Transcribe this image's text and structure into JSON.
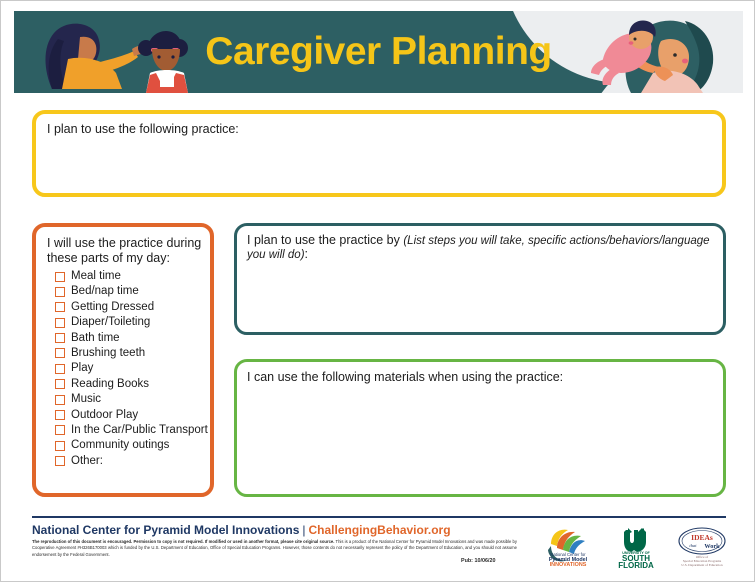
{
  "header": {
    "title": "Caregiver Planning",
    "banner_color": "#2d5f63",
    "title_color": "#f5c518",
    "left_illustration": "caregiver-styling-childs-hair-illustration",
    "right_illustration": "caregiver-holding-baby-illustration"
  },
  "sections": {
    "practice": {
      "label": "I plan to use the following practice:",
      "border_color": "#f7c71b"
    },
    "checklist": {
      "heading": "I will use the practice during these parts of my day:",
      "border_color": "#e0662a",
      "items": [
        "Meal time",
        "Bed/nap time",
        "Getting Dressed",
        "Diaper/Toileting",
        "Bath time",
        "Brushing teeth",
        "Play",
        "Reading Books",
        "Music",
        "Outdoor Play",
        "In the Car/Public Transport",
        "Community outings",
        "Other:"
      ]
    },
    "steps": {
      "label": "I plan to use the practice by ",
      "hint": "(List steps you will take, specific actions/behaviors/language you will do)",
      "suffix": ":",
      "border_color": "#2c5f63"
    },
    "materials": {
      "label": "I can use the following materials when using the practice:",
      "border_color": "#67b544"
    }
  },
  "footer": {
    "org": "National Center for Pyramid Model Innovations",
    "separator": "|",
    "url": "ChallengingBehavior.org",
    "org_color": "#1f3864",
    "url_color": "#e0662a",
    "fine_print_bold_1": "The reproduction of this document is encouraged. Permission to copy is not required. If modified or used in another format, please cite original source.",
    "fine_print_rest": " This is a product of the National Center for Pyramid Model Innovations and was made possible by Cooperative Agreement #H326B170003 which is funded by the U.S. Department of Education, Office of Special Education Programs. However, those contents do not necessarily represent the policy of the Department of Education, and you should not assume endorsement by the Federal Government.",
    "pub_date": "Pub: 10/06/20",
    "logos": [
      {
        "name": "ncpmi-logo",
        "line1": "National Center for",
        "line2": "Pyramid Model",
        "line3": "INNOVATIONS"
      },
      {
        "name": "usf-logo",
        "line1": "UNIVERSITY OF",
        "line2": "SOUTH",
        "line3": "FLORIDA"
      },
      {
        "name": "ideas-that-work-logo",
        "line1": "IDEAs",
        "line2": "that Work",
        "line3": "Office of",
        "line4": "Special Education Programs",
        "line5": "U.S. Department of Education"
      }
    ]
  }
}
